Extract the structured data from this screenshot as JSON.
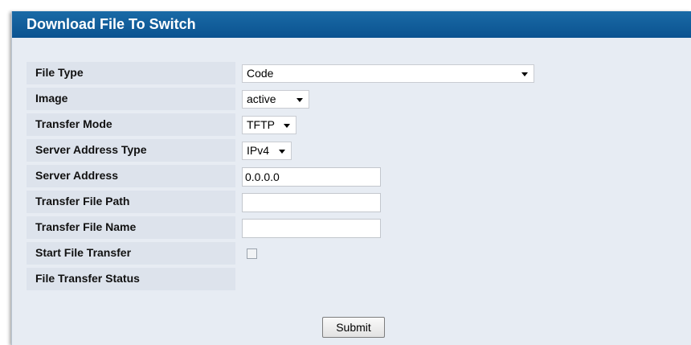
{
  "panel": {
    "title": "Download File To Switch"
  },
  "form": {
    "file_type": {
      "label": "File Type",
      "value": "Code"
    },
    "image": {
      "label": "Image",
      "value": "active"
    },
    "transfer_mode": {
      "label": "Transfer Mode",
      "value": "TFTP"
    },
    "server_address_type": {
      "label": "Server Address Type",
      "value": "IPv4"
    },
    "server_address": {
      "label": "Server Address",
      "value": "0.0.0.0"
    },
    "transfer_file_path": {
      "label": "Transfer File Path",
      "value": ""
    },
    "transfer_file_name": {
      "label": "Transfer File Name",
      "value": ""
    },
    "start_file_transfer": {
      "label": "Start File Transfer",
      "checked": false
    },
    "file_transfer_status": {
      "label": "File Transfer Status",
      "value": ""
    }
  },
  "actions": {
    "submit_label": "Submit"
  },
  "colors": {
    "header": "#0e5a96",
    "panel_bg": "#e7ecf3",
    "label_bg": "#dde3ec"
  }
}
